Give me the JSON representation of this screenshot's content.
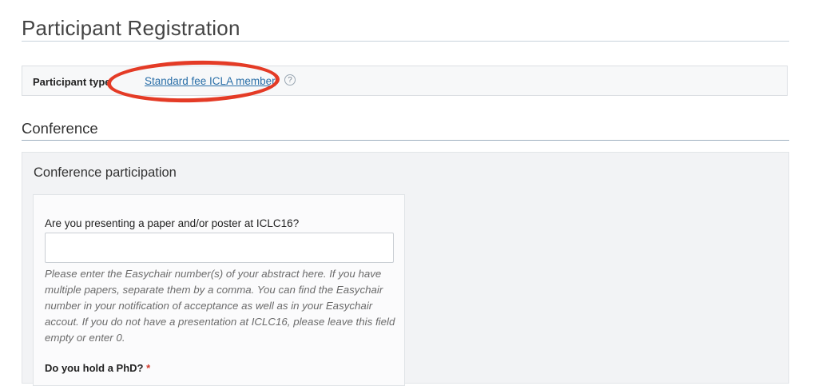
{
  "page": {
    "title": "Participant Registration"
  },
  "participant_type": {
    "label": "Participant type",
    "value": "Standard fee ICLA member",
    "help_icon": "?"
  },
  "section": {
    "title": "Conference"
  },
  "panel": {
    "title": "Conference participation",
    "questions": [
      {
        "label": "Are you presenting a paper and/or poster at ICLC16?",
        "value": "",
        "placeholder": "",
        "help_text": "Please enter the Easychair number(s) of your abstract here. If you have multiple papers, separate them by a comma. You can find the Easychair number in your notification of acceptance as well as in your Easychair accout. If you do not have a presentation at ICLC16, please leave this field empty or enter 0."
      },
      {
        "label": "Do you hold a PhD?",
        "required_marker": "*"
      }
    ]
  },
  "colors": {
    "link": "#2a6fa8",
    "annotation": "#e43b26",
    "required": "#d0382b"
  }
}
